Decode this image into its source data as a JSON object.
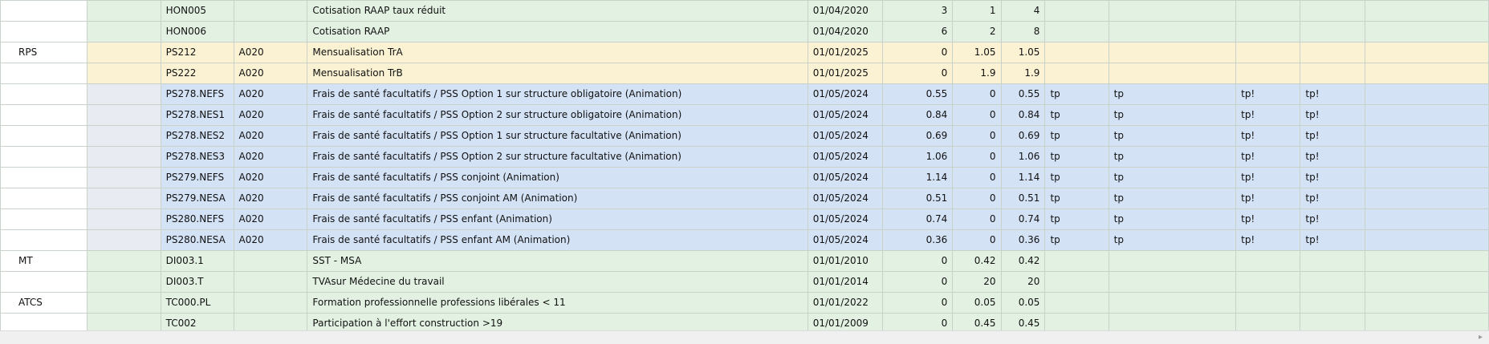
{
  "rows": [
    {
      "style": "green",
      "c0": "",
      "c1": "",
      "c2": "HON005",
      "c3": "",
      "c4": "Cotisation RAAP taux réduit",
      "c5": "01/04/2020",
      "c6": "3",
      "c7": "1",
      "c8": "4",
      "c9": "",
      "c10": "",
      "c11": "",
      "c12": ""
    },
    {
      "style": "green",
      "c0": "",
      "c1": "",
      "c2": "HON006",
      "c3": "",
      "c4": "Cotisation RAAP",
      "c5": "01/04/2020",
      "c6": "6",
      "c7": "2",
      "c8": "8",
      "c9": "",
      "c10": "",
      "c11": "",
      "c12": ""
    },
    {
      "style": "yellow",
      "c0": "RPS",
      "c1": "",
      "c2": "PS212",
      "c3": "A020",
      "c4": "Mensualisation TrA",
      "c5": "01/01/2025",
      "c6": "0",
      "c7": "1.05",
      "c8": "1.05",
      "c9": "",
      "c10": "",
      "c11": "",
      "c12": ""
    },
    {
      "style": "yellow",
      "c0": "",
      "c1": "",
      "c2": "PS222",
      "c3": "A020",
      "c4": "Mensualisation TrB",
      "c5": "01/01/2025",
      "c6": "0",
      "c7": "1.9",
      "c8": "1.9",
      "c9": "",
      "c10": "",
      "c11": "",
      "c12": ""
    },
    {
      "style": "blue",
      "c0": "",
      "c1": "",
      "c2": "PS278.NEFS",
      "c3": "A020",
      "c4": "Frais de santé facultatifs / PSS Option 1 sur structure obligatoire (Animation)",
      "c5": "01/05/2024",
      "c6": "0.55",
      "c7": "0",
      "c8": "0.55",
      "c9": "tp",
      "c10": "tp",
      "c11": "tp!",
      "c12": "tp!"
    },
    {
      "style": "blue",
      "c0": "",
      "c1": "",
      "c2": "PS278.NES1",
      "c3": "A020",
      "c4": "Frais de santé facultatifs / PSS Option 2 sur structure obligatoire (Animation)",
      "c5": "01/05/2024",
      "c6": "0.84",
      "c7": "0",
      "c8": "0.84",
      "c9": "tp",
      "c10": "tp",
      "c11": "tp!",
      "c12": "tp!"
    },
    {
      "style": "blue",
      "c0": "",
      "c1": "",
      "c2": "PS278.NES2",
      "c3": "A020",
      "c4": "Frais de santé facultatifs / PSS Option 1 sur structure facultative (Animation)",
      "c5": "01/05/2024",
      "c6": "0.69",
      "c7": "0",
      "c8": "0.69",
      "c9": "tp",
      "c10": "tp",
      "c11": "tp!",
      "c12": "tp!"
    },
    {
      "style": "blue",
      "c0": "",
      "c1": "",
      "c2": "PS278.NES3",
      "c3": "A020",
      "c4": "Frais de santé facultatifs / PSS Option 2 sur structure facultative (Animation)",
      "c5": "01/05/2024",
      "c6": "1.06",
      "c7": "0",
      "c8": "1.06",
      "c9": "tp",
      "c10": "tp",
      "c11": "tp!",
      "c12": "tp!"
    },
    {
      "style": "blue",
      "c0": "",
      "c1": "",
      "c2": "PS279.NEFS",
      "c3": "A020",
      "c4": "Frais de santé facultatifs / PSS conjoint (Animation)",
      "c5": "01/05/2024",
      "c6": "1.14",
      "c7": "0",
      "c8": "1.14",
      "c9": "tp",
      "c10": "tp",
      "c11": "tp!",
      "c12": "tp!"
    },
    {
      "style": "blue",
      "c0": "",
      "c1": "",
      "c2": "PS279.NESA",
      "c3": "A020",
      "c4": "Frais de santé facultatifs / PSS conjoint AM (Animation)",
      "c5": "01/05/2024",
      "c6": "0.51",
      "c7": "0",
      "c8": "0.51",
      "c9": "tp",
      "c10": "tp",
      "c11": "tp!",
      "c12": "tp!"
    },
    {
      "style": "blue",
      "c0": "",
      "c1": "",
      "c2": "PS280.NEFS",
      "c3": "A020",
      "c4": "Frais de santé facultatifs / PSS enfant (Animation)",
      "c5": "01/05/2024",
      "c6": "0.74",
      "c7": "0",
      "c8": "0.74",
      "c9": "tp",
      "c10": "tp",
      "c11": "tp!",
      "c12": "tp!"
    },
    {
      "style": "blue",
      "c0": "",
      "c1": "",
      "c2": "PS280.NESA",
      "c3": "A020",
      "c4": "Frais de santé facultatifs / PSS enfant AM (Animation)",
      "c5": "01/05/2024",
      "c6": "0.36",
      "c7": "0",
      "c8": "0.36",
      "c9": "tp",
      "c10": "tp",
      "c11": "tp!",
      "c12": "tp!"
    },
    {
      "style": "green",
      "c0": "MT",
      "c1": "",
      "c2": "DI003.1",
      "c3": "",
      "c4": "SST - MSA",
      "c5": "01/01/2010",
      "c6": "0",
      "c7": "0.42",
      "c8": "0.42",
      "c9": "",
      "c10": "",
      "c11": "",
      "c12": ""
    },
    {
      "style": "green",
      "c0": "",
      "c1": "",
      "c2": "DI003.T",
      "c3": "",
      "c4": "TVAsur Médecine du travail",
      "c5": "01/01/2014",
      "c6": "0",
      "c7": "20",
      "c8": "20",
      "c9": "",
      "c10": "",
      "c11": "",
      "c12": ""
    },
    {
      "style": "green",
      "c0": "ATCS",
      "c1": "",
      "c2": "TC000.PL",
      "c3": "",
      "c4": "Formation professionnelle professions libérales < 11",
      "c5": "01/01/2022",
      "c6": "0",
      "c7": "0.05",
      "c8": "0.05",
      "c9": "",
      "c10": "",
      "c11": "",
      "c12": ""
    },
    {
      "style": "green",
      "c0": "",
      "c1": "",
      "c2": "TC002",
      "c3": "",
      "c4": "Participation à l'effort construction >19",
      "c5": "01/01/2009",
      "c6": "0",
      "c7": "0.45",
      "c8": "0.45",
      "c9": "",
      "c10": "",
      "c11": "",
      "c12": ""
    }
  ],
  "colors": {
    "green": "#e3f1e3",
    "yellow": "#faf2d3",
    "blue": "#d4e2f6"
  },
  "scrollbar": {
    "arrow_icon": "chevron-right-icon"
  }
}
